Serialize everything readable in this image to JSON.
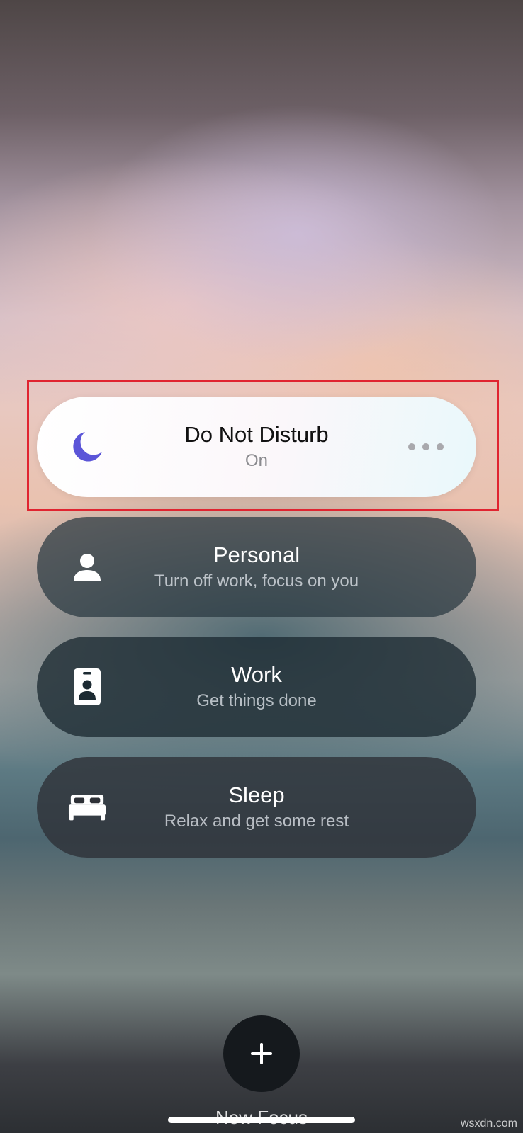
{
  "focus_modes": [
    {
      "title": "Do Not Disturb",
      "subtitle": "On",
      "icon": "moon-icon",
      "icon_color": "#5b55d8",
      "active": true
    },
    {
      "title": "Personal",
      "subtitle": "Turn off work, focus on you",
      "icon": "person-icon",
      "active": false
    },
    {
      "title": "Work",
      "subtitle": "Get things done",
      "icon": "id-badge-icon",
      "active": false
    },
    {
      "title": "Sleep",
      "subtitle": "Relax and get some rest",
      "icon": "bed-icon",
      "active": false
    }
  ],
  "more_button": {
    "icon": "ellipsis-icon"
  },
  "new_focus": {
    "label": "New Focus",
    "icon": "plus-icon"
  },
  "highlight_color": "#e02430",
  "watermark": "wsxdn.com"
}
